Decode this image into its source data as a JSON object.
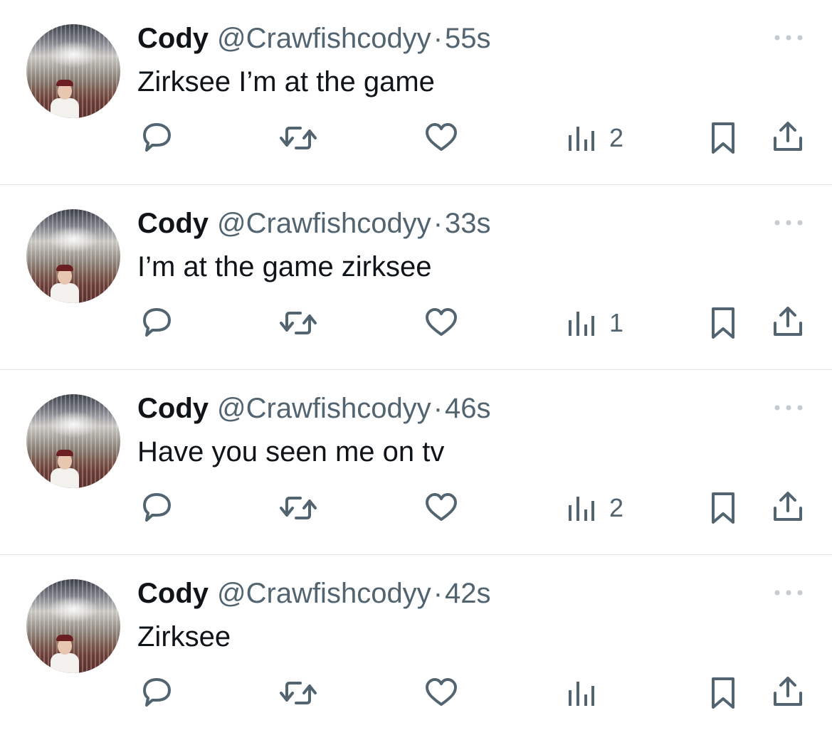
{
  "tweets": [
    {
      "name": "Cody",
      "handle": "@Crawfishcodyy",
      "separator": "·",
      "time": "55s",
      "text": "Zirksee I’m at the game",
      "views": "2"
    },
    {
      "name": "Cody",
      "handle": "@Crawfishcodyy",
      "separator": "·",
      "time": "33s",
      "text": "I’m at the game zirksee",
      "views": "1"
    },
    {
      "name": "Cody",
      "handle": "@Crawfishcodyy",
      "separator": "·",
      "time": "46s",
      "text": "Have you seen me on tv",
      "views": "2"
    },
    {
      "name": "Cody",
      "handle": "@Crawfishcodyy",
      "separator": "·",
      "time": "42s",
      "text": "Zirksee",
      "views": ""
    }
  ],
  "icons": {
    "more": "more-options-icon",
    "reply": "reply-icon",
    "retweet": "retweet-icon",
    "like": "heart-icon",
    "views": "views-icon",
    "bookmark": "bookmark-icon",
    "share": "share-icon"
  },
  "colors": {
    "text": "#0f1419",
    "secondary": "#536471",
    "divider": "#e1e4e8"
  }
}
